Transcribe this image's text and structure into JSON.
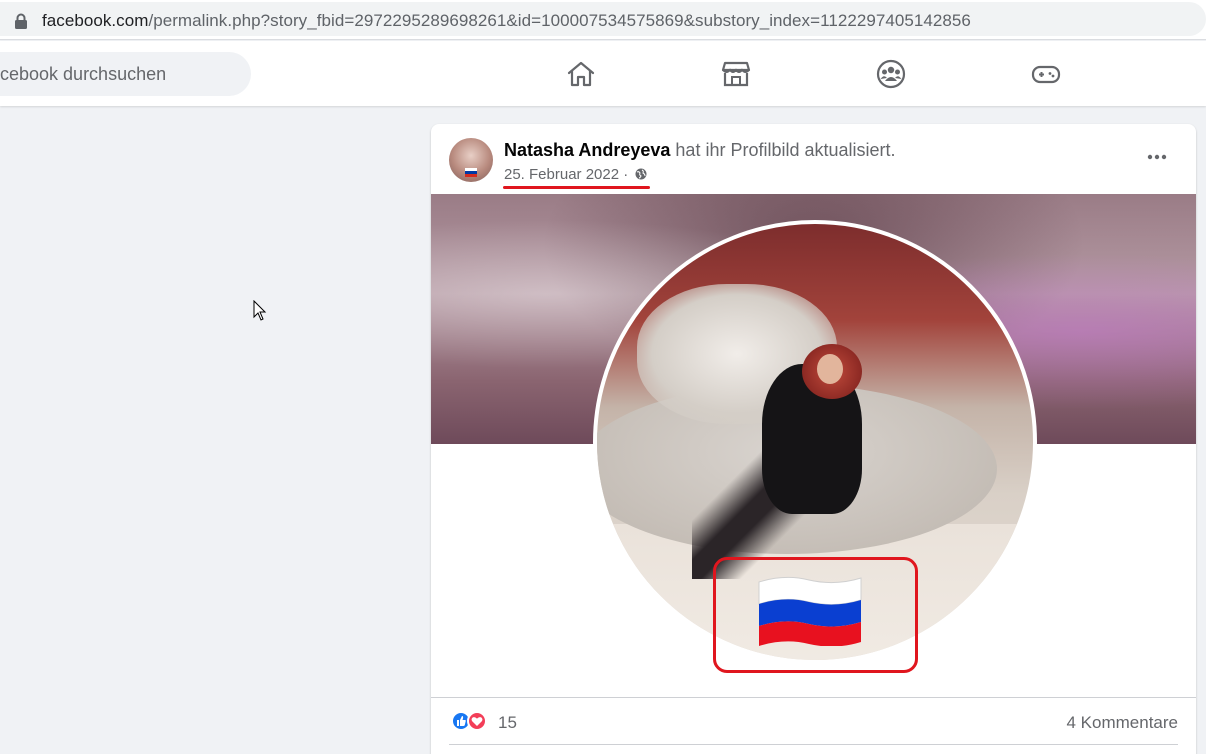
{
  "browser": {
    "url_host": "facebook.com",
    "url_rest": "/permalink.php?story_fbid=2972295289698261&id=100007534575869&substory_index=1122297405142856"
  },
  "fbnav": {
    "search_placeholder": "cebook durchsuchen",
    "icons": [
      "home-icon",
      "marketplace-icon",
      "groups-icon",
      "gaming-icon"
    ]
  },
  "post": {
    "author": "Natasha Andreyeva",
    "action": " hat ihr Profilbild aktualisiert.",
    "date": "25. Februar 2022",
    "separator": " · ",
    "reaction_count": "15",
    "comments": "4 Kommentare"
  },
  "colors": {
    "annotation_red": "#e0161e",
    "fb_blue": "#1877f2",
    "love_red": "#f33e58"
  }
}
